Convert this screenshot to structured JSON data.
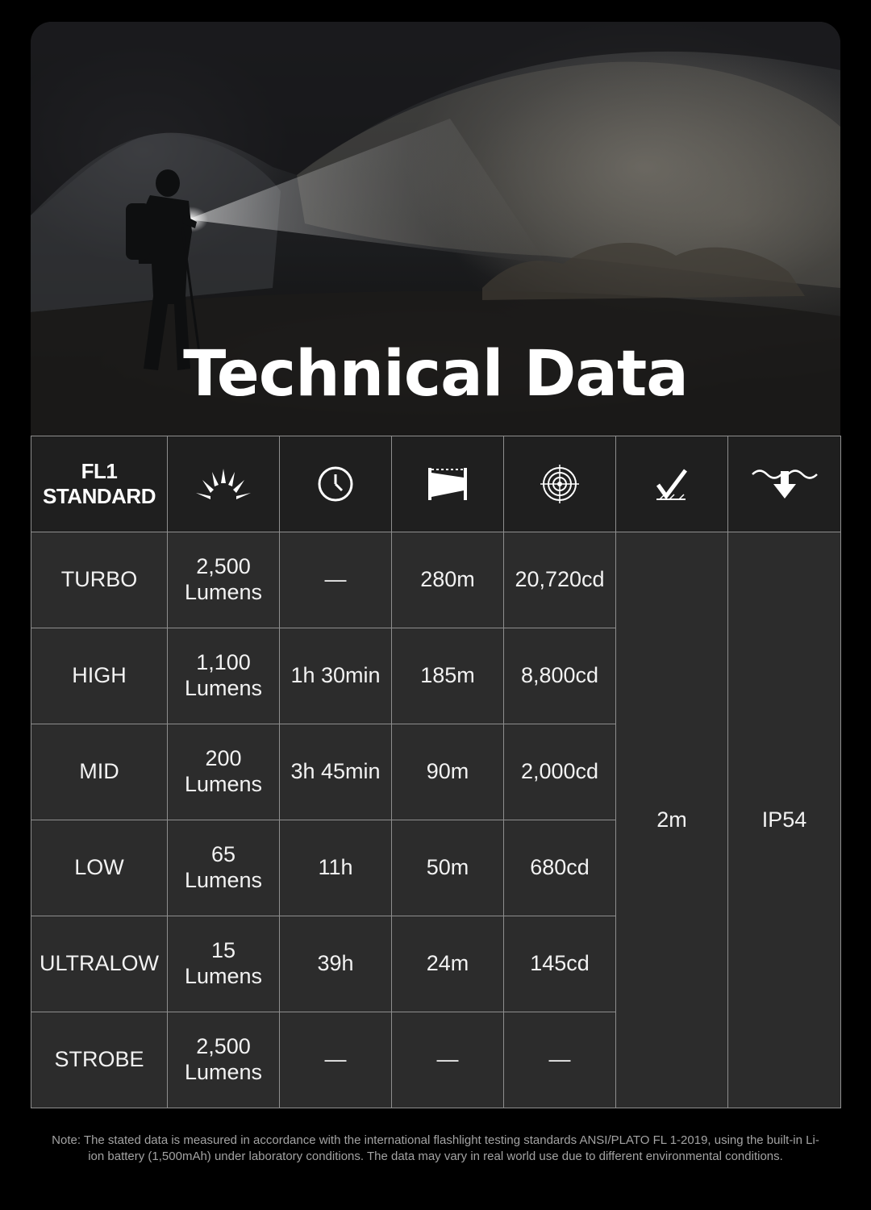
{
  "hero": {
    "title": "Technical Data"
  },
  "table": {
    "header_label_line1": "FL1",
    "header_label_line2": "STANDARD",
    "header_icons": [
      "brightness-icon",
      "clock-icon",
      "beam-distance-icon",
      "intensity-target-icon",
      "impact-resistance-icon",
      "water-resistance-icon"
    ],
    "rows": [
      {
        "mode": "TURBO",
        "lumens_value": "2,500",
        "lumens_unit": "Lumens",
        "runtime": "—",
        "distance": "280m",
        "intensity": "20,720cd"
      },
      {
        "mode": "HIGH",
        "lumens_value": "1,100",
        "lumens_unit": "Lumens",
        "runtime": "1h 30min",
        "distance": "185m",
        "intensity": "8,800cd"
      },
      {
        "mode": "MID",
        "lumens_value": "200",
        "lumens_unit": "Lumens",
        "runtime": "3h 45min",
        "distance": "90m",
        "intensity": "2,000cd"
      },
      {
        "mode": "LOW",
        "lumens_value": "65",
        "lumens_unit": "Lumens",
        "runtime": "11h",
        "distance": "50m",
        "intensity": "680cd"
      },
      {
        "mode": "ULTRALOW",
        "lumens_value": "15",
        "lumens_unit": "Lumens",
        "runtime": "39h",
        "distance": "24m",
        "intensity": "145cd"
      },
      {
        "mode": "STROBE",
        "lumens_value": "2,500",
        "lumens_unit": "Lumens",
        "runtime": "—",
        "distance": "—",
        "intensity": "—"
      }
    ],
    "impact_resistance": "2m",
    "water_resistance": "IP54"
  },
  "note": "Note: The stated data is measured in accordance with the international flashlight testing standards ANSI/PLATO FL 1-2019, using the built-in Li-ion battery (1,500mAh) under laboratory conditions. The data may vary in real world use due to different environmental conditions.",
  "colors": {
    "background": "#000000",
    "header_cell": "#1f1f1f",
    "body_cell": "#2c2c2c",
    "border": "#8e8e8e",
    "note_text": "#a3a3a3"
  }
}
